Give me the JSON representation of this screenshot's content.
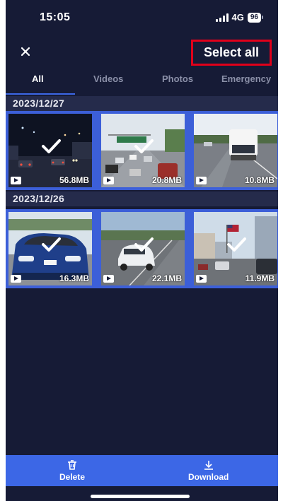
{
  "status_bar": {
    "time": "15:05",
    "network": "4G",
    "battery": "96"
  },
  "header": {
    "close_icon": "close-icon",
    "select_all_label": "Select all"
  },
  "tabs": [
    {
      "label": "All",
      "active": true
    },
    {
      "label": "Videos",
      "active": false
    },
    {
      "label": "Photos",
      "active": false
    },
    {
      "label": "Emergency",
      "active": false
    }
  ],
  "sections": [
    {
      "date": "2023/12/27",
      "items": [
        {
          "size": "56.8MB",
          "type": "video"
        },
        {
          "size": "20.8MB",
          "type": "video"
        },
        {
          "size": "10.8MB",
          "type": "video"
        }
      ]
    },
    {
      "date": "2023/12/26",
      "items": [
        {
          "size": "16.3MB",
          "type": "video"
        },
        {
          "size": "22.1MB",
          "type": "video"
        },
        {
          "size": "11.9MB",
          "type": "video"
        }
      ]
    }
  ],
  "bottom_bar": {
    "delete_label": "Delete",
    "download_label": "Download"
  },
  "colors": {
    "background": "#161b36",
    "accent": "#3c67e6",
    "highlight": "#e1001a"
  }
}
